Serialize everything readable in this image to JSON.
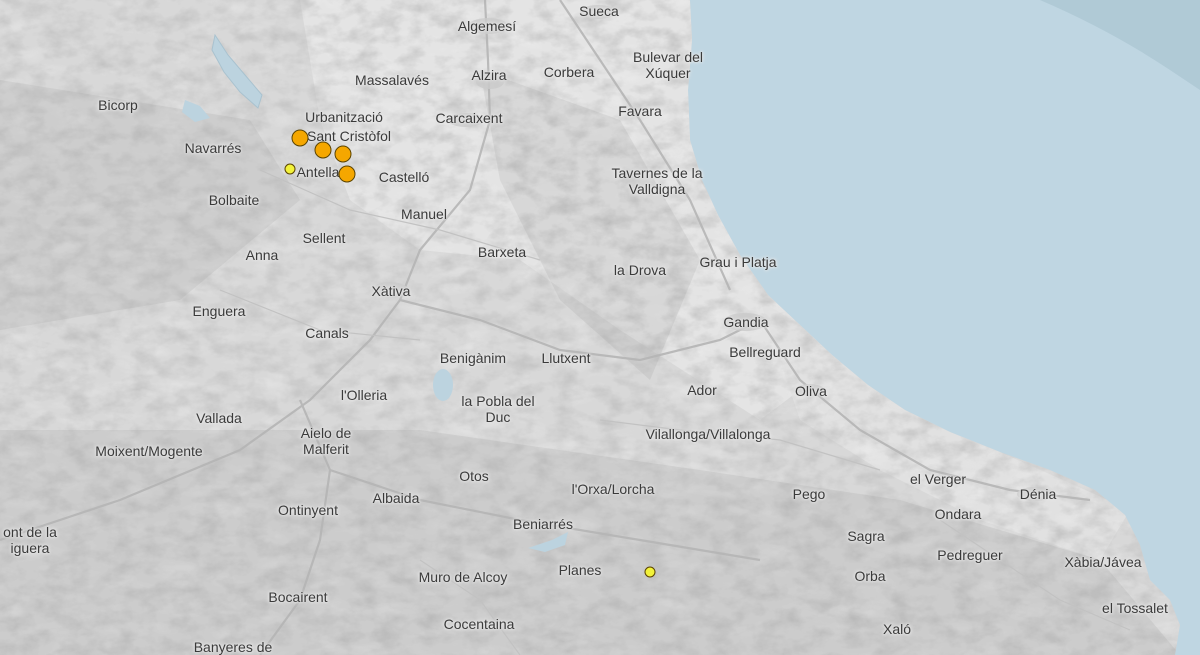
{
  "colors": {
    "sea": "#bfd6e2",
    "land": "#d8d8d8",
    "quake_strong": "#f5a700",
    "quake_weak": "#f2f23a"
  },
  "places": {
    "algemesi": "Algemesí",
    "sueca": "Sueca",
    "bulevar_l1": "Bulevar del",
    "bulevar_l2": "Xúquer",
    "massalaves": "Massalavés",
    "alzira": "Alzira",
    "corbera": "Corbera",
    "bicorp": "Bicorp",
    "urbanitzacio": "Urbanització",
    "sant_cristofol": "Sant Cristòfol",
    "carcaixent": "Carcaixent",
    "favara": "Favara",
    "navarres": "Navarrés",
    "antella": "Antella",
    "castello": "Castelló",
    "tavernes_l1": "Tavernes de la",
    "tavernes_l2": "Valldigna",
    "bolbaite": "Bolbaite",
    "manuel": "Manuel",
    "sellent": "Sellent",
    "barxeta": "Barxeta",
    "anna": "Anna",
    "grau": "Grau i Platja",
    "la_drova": "la Drova",
    "xativa": "Xàtiva",
    "enguera": "Enguera",
    "gandia": "Gandia",
    "canals": "Canals",
    "beniganim": "Benigànim",
    "lluxent": "Llutxent",
    "bellreguard": "Bellreguard",
    "ador": "Ador",
    "lolleria": "l'Olleria",
    "oliva": "Oliva",
    "pobla_l1": "la Pobla del",
    "pobla_l2": "Duc",
    "vallada": "Vallada",
    "aielo_l1": "Aielo de",
    "aielo_l2": "Malferit",
    "vilallonga": "Vilallonga/Villalonga",
    "moixent": "Moixent/Mogente",
    "otos": "Otos",
    "el_verger": "el Verger",
    "lorxa": "l'Orxa/Lorcha",
    "albaida": "Albaida",
    "pego": "Pego",
    "denia": "Dénia",
    "ontinyent": "Ontinyent",
    "ondara": "Ondara",
    "font_l1": "ont de la",
    "font_l2": "iguera",
    "beniarres": "Beniarrés",
    "sagra": "Sagra",
    "pedreguer": "Pedreguer",
    "xabia": "Xàbia/Jávea",
    "muro": "Muro de Alcoy",
    "planes": "Planes",
    "orba": "Orba",
    "bocairent": "Bocairent",
    "el_tossalet": "el Tossalet",
    "cocentaina": "Cocentaina",
    "xalo": "Xaló",
    "banyeres": "Banyeres de"
  },
  "earthquakes": [
    {
      "id": "q1",
      "level": "strong"
    },
    {
      "id": "q2",
      "level": "strong"
    },
    {
      "id": "q3",
      "level": "strong"
    },
    {
      "id": "q4",
      "level": "strong"
    },
    {
      "id": "q5",
      "level": "weak"
    },
    {
      "id": "q6",
      "level": "weak"
    }
  ]
}
